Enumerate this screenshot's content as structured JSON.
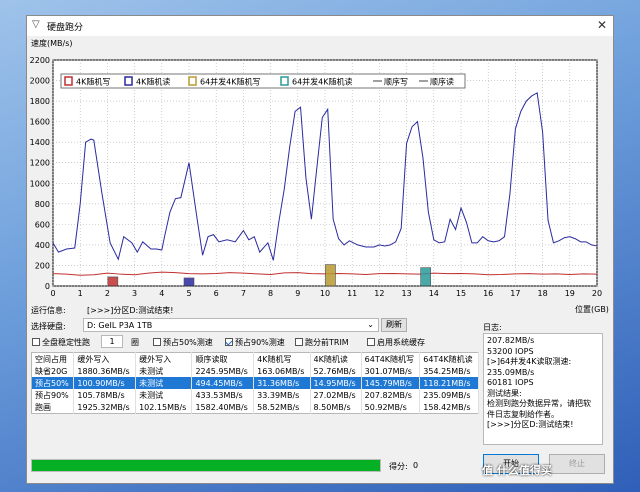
{
  "window": {
    "title": "硬盘跑分"
  },
  "chart": {
    "ylabel": "速度(MB/s)",
    "xlabel": "位置(GB)",
    "yticks": [
      "2200",
      "2000",
      "1800",
      "1600",
      "1400",
      "1200",
      "1000",
      "800",
      "600",
      "400",
      "200",
      "0"
    ],
    "xticks": [
      "0",
      "1",
      "2",
      "3",
      "4",
      "5",
      "6",
      "7",
      "8",
      "9",
      "10",
      "11",
      "12",
      "13",
      "14",
      "15",
      "16",
      "17",
      "18",
      "19",
      "20"
    ],
    "legend": [
      {
        "label": "4K随机写",
        "color": "#c03030",
        "kind": "box"
      },
      {
        "label": "4K随机读",
        "color": "#2a2aa0",
        "kind": "box"
      },
      {
        "label": "64并发4K随机写",
        "color": "#b89a30",
        "kind": "box"
      },
      {
        "label": "64并发4K随机读",
        "color": "#2a9a9a",
        "kind": "box"
      },
      {
        "label": "顺序写",
        "color": "#404040",
        "kind": "line"
      },
      {
        "label": "顺序读",
        "color": "#404040",
        "kind": "line"
      }
    ]
  },
  "chart_data": {
    "type": "line",
    "xlabel": "位置(GB)",
    "ylabel": "速度(MB/s)",
    "xlim": [
      0,
      20
    ],
    "ylim": [
      0,
      2200
    ],
    "series": [
      {
        "name": "4K随机读",
        "color": "#2a2aa0",
        "x": [
          0,
          0.2,
          0.5,
          0.8,
          1.0,
          1.2,
          1.4,
          1.5,
          1.8,
          2.1,
          2.4,
          2.6,
          2.9,
          3.1,
          3.3,
          3.6,
          3.8,
          4.0,
          4.1,
          4.3,
          4.5,
          4.7,
          5.0,
          5.3,
          5.5,
          5.7,
          5.9,
          6.1,
          6.4,
          6.7,
          7.0,
          7.2,
          7.4,
          7.6,
          7.9,
          8.1,
          8.3,
          8.5,
          8.7,
          8.9,
          9.1,
          9.3,
          9.5,
          9.7,
          9.9,
          10.1,
          10.3,
          10.5,
          10.7,
          10.9,
          11.2,
          11.5,
          11.8,
          12.0,
          12.2,
          12.4,
          12.6,
          12.8,
          13.0,
          13.2,
          13.4,
          13.6,
          13.8,
          14.0,
          14.2,
          14.4,
          14.6,
          14.8,
          15.0,
          15.2,
          15.4,
          15.6,
          15.8,
          16.0,
          16.2,
          16.4,
          16.6,
          16.8,
          17.0,
          17.2,
          17.4,
          17.6,
          17.8,
          18.0,
          18.2,
          18.4,
          18.6,
          18.8,
          19.0,
          19.2,
          19.4,
          19.6,
          19.8,
          20.0
        ],
        "y": [
          420,
          330,
          360,
          370,
          800,
          1400,
          1430,
          1420,
          900,
          420,
          260,
          480,
          420,
          330,
          430,
          360,
          360,
          350,
          480,
          720,
          850,
          860,
          1200,
          650,
          300,
          480,
          500,
          430,
          450,
          430,
          540,
          450,
          480,
          330,
          420,
          250,
          620,
          940,
          1350,
          1700,
          1740,
          1050,
          650,
          1150,
          1640,
          1720,
          650,
          460,
          400,
          440,
          400,
          380,
          380,
          400,
          390,
          400,
          430,
          560,
          1390,
          1550,
          1600,
          1250,
          720,
          450,
          420,
          430,
          650,
          550,
          760,
          620,
          420,
          420,
          480,
          440,
          430,
          440,
          480,
          900,
          1530,
          1700,
          1800,
          1850,
          1880,
          1500,
          640,
          420,
          440,
          470,
          480,
          460,
          430,
          430,
          400,
          390
        ]
      },
      {
        "name": "4K随机写",
        "color": "#c03030",
        "x": [
          0,
          0.5,
          1,
          1.5,
          2,
          2.5,
          3,
          3.5,
          4,
          4.5,
          5,
          5.5,
          6,
          6.5,
          7,
          7.5,
          8,
          8.5,
          9,
          9.5,
          10,
          10.5,
          11,
          11.5,
          12,
          12.5,
          13,
          13.5,
          14,
          14.5,
          15,
          15.5,
          16,
          16.5,
          17,
          17.5,
          18,
          18.5,
          19,
          19.5,
          20
        ],
        "y": [
          120,
          115,
          105,
          110,
          125,
          115,
          110,
          125,
          135,
          130,
          120,
          118,
          122,
          130,
          125,
          118,
          112,
          128,
          130,
          120,
          118,
          122,
          118,
          112,
          120,
          122,
          118,
          115,
          125,
          120,
          122,
          118,
          110,
          112,
          118,
          120,
          115,
          118,
          112,
          118,
          115
        ]
      }
    ],
    "markers": [
      {
        "name": "64并发4K随机写",
        "x": 10.2,
        "y": 150,
        "color": "#b89a30"
      },
      {
        "name": "64并发4K随机读",
        "x": 13.7,
        "y": 120,
        "color": "#2a9a9a"
      },
      {
        "name": "4K随机写",
        "x": 2.2,
        "y": 30,
        "color": "#c03030"
      },
      {
        "name": "4K随机读",
        "x": 5.0,
        "y": 20,
        "color": "#2a2aa0"
      }
    ]
  },
  "status": {
    "label": "运行信息:",
    "text": "[>>>]分区D:测试结束!"
  },
  "disk": {
    "label": "选择硬盘:",
    "value": "D: GeIL P3A 1TB",
    "refresh": "刷新"
  },
  "options": {
    "full_stable": "全盘稳定性跑",
    "count": "1",
    "rounds": "圈",
    "pre50": "预占50%测速",
    "pre90": "预占90%测速",
    "trim": "跑分前TRIM",
    "cache": "启用系统缓存"
  },
  "log": {
    "label": "日志:",
    "lines": [
      "207.82MB/s",
      "53200 IOPS",
      "[>]64并发4K读取测速:",
      "235.09MB/s",
      "60181 IOPS",
      "测试结果:",
      "检测到跑分数据异常，请把软",
      "件日志复制给作者。",
      "[>>>]分区D:测试结束!"
    ]
  },
  "table": {
    "headers": [
      "空间占用",
      "缓外写入",
      "缓外写入",
      "顺序读取",
      "4K随机写",
      "4K随机读",
      "64T4K随机写",
      "64T4K随机读"
    ],
    "rows": [
      [
        "缺省20G",
        "1880.36MB/s",
        "未测试",
        "2245.95MB/s",
        "163.06MB/s",
        "52.76MB/s",
        "301.07MB/s",
        "354.25MB/s"
      ],
      [
        "预占50%",
        "100.90MB/s",
        "未测试",
        "494.45MB/s",
        "31.36MB/s",
        "14.95MB/s",
        "145.79MB/s",
        "118.21MB/s"
      ],
      [
        "预占90%",
        "105.78MB/s",
        "未测试",
        "433.53MB/s",
        "33.39MB/s",
        "27.02MB/s",
        "207.82MB/s",
        "235.09MB/s"
      ],
      [
        "跑画",
        "1925.32MB/s",
        "102.15MB/s",
        "1582.40MB/s",
        "58.52MB/s",
        "8.50MB/s",
        "50.92MB/s",
        "158.42MB/s"
      ]
    ]
  },
  "progress": {
    "value": 1.0
  },
  "score": {
    "label": "得分:",
    "value": "0"
  },
  "actions": {
    "start": "开始",
    "stop": "终止"
  },
  "watermark": "值 什么值得买"
}
